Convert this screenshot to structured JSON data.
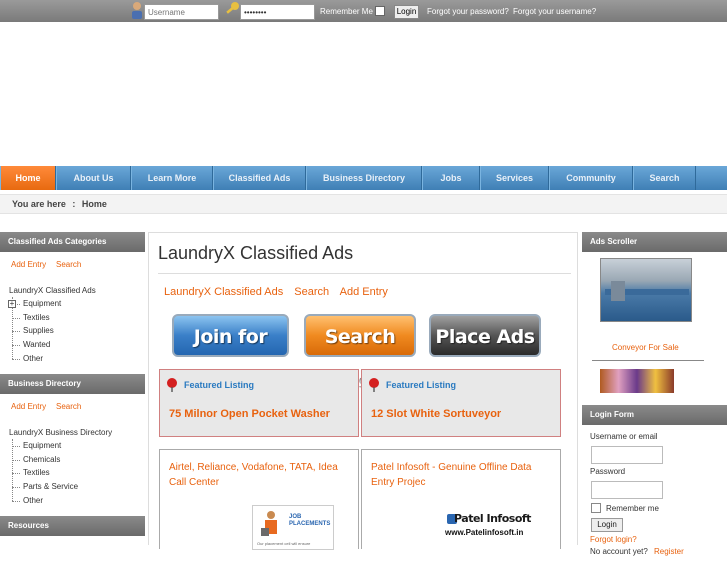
{
  "topbar": {
    "username_placeholder": "Username",
    "password_value": "••••••••",
    "remember_label": "Remember Me",
    "login_label": "Login",
    "forgot_password": "Forgot your password?",
    "forgot_username": "Forgot your username?"
  },
  "nav": {
    "items": [
      "Home",
      "About Us",
      "Learn More",
      "Classified Ads",
      "Business Directory",
      "Jobs",
      "Services",
      "Community",
      "Search"
    ]
  },
  "breadcrumb": {
    "prefix": "You are here",
    "separator": ":",
    "current": "Home"
  },
  "left": {
    "classified": {
      "title": "Classified Ads Categories",
      "links": [
        "Add Entry",
        "Search"
      ],
      "root": "LaundryX Classified Ads",
      "items": [
        "Equipment",
        "Textiles",
        "Supplies",
        "Wanted",
        "Other"
      ]
    },
    "directory": {
      "title": "Business Directory",
      "links": [
        "Add Entry",
        "Search"
      ],
      "root": "LaundryX Business Directory",
      "items": [
        "Equipment",
        "Chemicals",
        "Textiles",
        "Parts & Service",
        "Other"
      ]
    },
    "resources": {
      "title": "Resources"
    }
  },
  "main": {
    "title": "LaundryX Classified Ads",
    "links": [
      "LaundryX Classified Ads",
      "Search",
      "Add Entry"
    ],
    "buttons": [
      "Join for Free",
      "Search Ads",
      "Place Ads"
    ],
    "featured_label": "Featured Listing",
    "featured": [
      "75 Milnor Open Pocket Washer",
      "12 Slot White Sortuveyor"
    ],
    "ads": [
      {
        "title": "Airtel, Reliance, Vodafone, TATA, Idea Call Center",
        "logo_text": "JOB PLACEMENTS",
        "logo_caption": "Our placement cell will ensure"
      },
      {
        "title": "Patel Infosoft - Genuine Offline Data Entry Projec",
        "logo_text": "Patel Infosoft",
        "logo_url_text": "www.Patelinfosoft.in"
      }
    ]
  },
  "right": {
    "scroller": {
      "title": "Ads Scroller",
      "caption": "Conveyor For Sale"
    },
    "login": {
      "title": "Login Form",
      "username_label": "Username or email",
      "password_label": "Password",
      "remember_label": "Remember me",
      "login_label": "Login",
      "forgot": "Forgot login?",
      "no_account": "No account yet?",
      "register": "Register"
    }
  },
  "colors": {
    "accent": "#e8620f",
    "nav_blue": "#4f8fc5",
    "featured_blue": "#2a7ac0"
  }
}
